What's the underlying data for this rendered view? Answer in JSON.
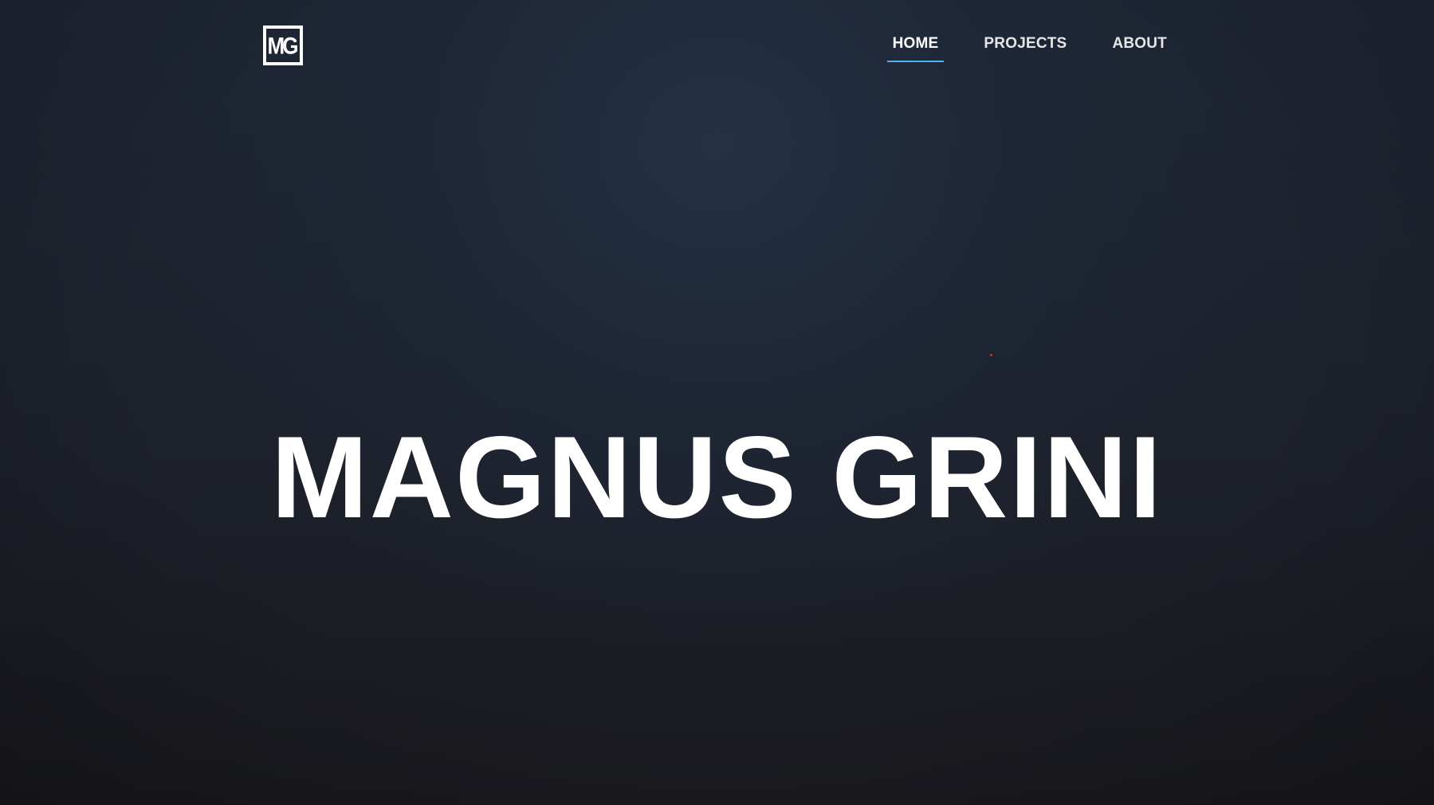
{
  "header": {
    "logo_text": "MG",
    "nav": [
      {
        "label": "HOME",
        "active": true
      },
      {
        "label": "PROJECTS",
        "active": false
      },
      {
        "label": "ABOUT",
        "active": false
      }
    ]
  },
  "hero": {
    "title": "MAGNUS GRINI"
  },
  "colors": {
    "background_top": "#1e2533",
    "background_bottom": "#1a1a1f",
    "text": "#ffffff",
    "nav_active_underline": "#4fb3e8",
    "dot": "#c0392b"
  }
}
